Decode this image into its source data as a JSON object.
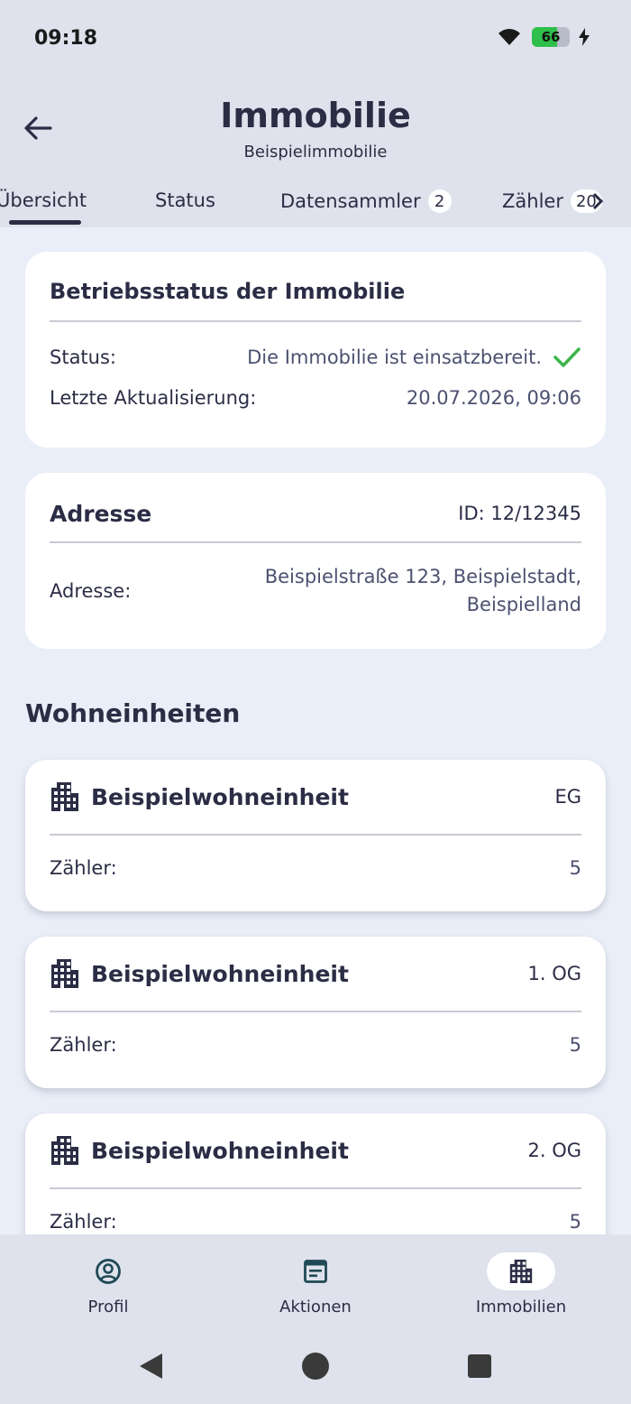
{
  "status_bar": {
    "time": "09:18",
    "battery": "66"
  },
  "header": {
    "title": "Immobilie",
    "subtitle": "Beispielimmobilie"
  },
  "tabs": [
    {
      "label": "Übersicht",
      "badge": ""
    },
    {
      "label": "Status",
      "badge": ""
    },
    {
      "label": "Datensammler",
      "badge": "2"
    },
    {
      "label": "Zähler",
      "badge": "20"
    }
  ],
  "status_card": {
    "title": "Betriebsstatus der Immobilie",
    "status_label": "Status:",
    "status_value": "Die Immobilie ist einsatzbereit.",
    "update_label": "Letzte Aktualisierung:",
    "update_value": "20.07.2026, 09:06"
  },
  "address_card": {
    "title": "Adresse",
    "id": "ID: 12/12345",
    "address_label": "Adresse:",
    "address_line1": "Beispielstraße 123, Beispielstadt,",
    "address_line2": "Beispielland"
  },
  "units_section": {
    "title": "Wohneinheiten"
  },
  "units": [
    {
      "name": "Beispielwohneinheit",
      "floor": "EG",
      "meter_label": "Zähler:",
      "meter_count": "5"
    },
    {
      "name": "Beispielwohneinheit",
      "floor": "1. OG",
      "meter_label": "Zähler:",
      "meter_count": "5"
    },
    {
      "name": "Beispielwohneinheit",
      "floor": "2. OG",
      "meter_label": "Zähler:",
      "meter_count": "5"
    }
  ],
  "bottom_nav": [
    {
      "label": "Profil",
      "icon": "profile-icon",
      "active": false
    },
    {
      "label": "Aktionen",
      "icon": "actions-icon",
      "active": false
    },
    {
      "label": "Immobilien",
      "icon": "building-icon",
      "active": true
    }
  ],
  "colors": {
    "accent_dark": "#2b2d45",
    "success": "#3cb54a",
    "nav_icon": "#1f4a55",
    "background": "#eaeef8"
  }
}
